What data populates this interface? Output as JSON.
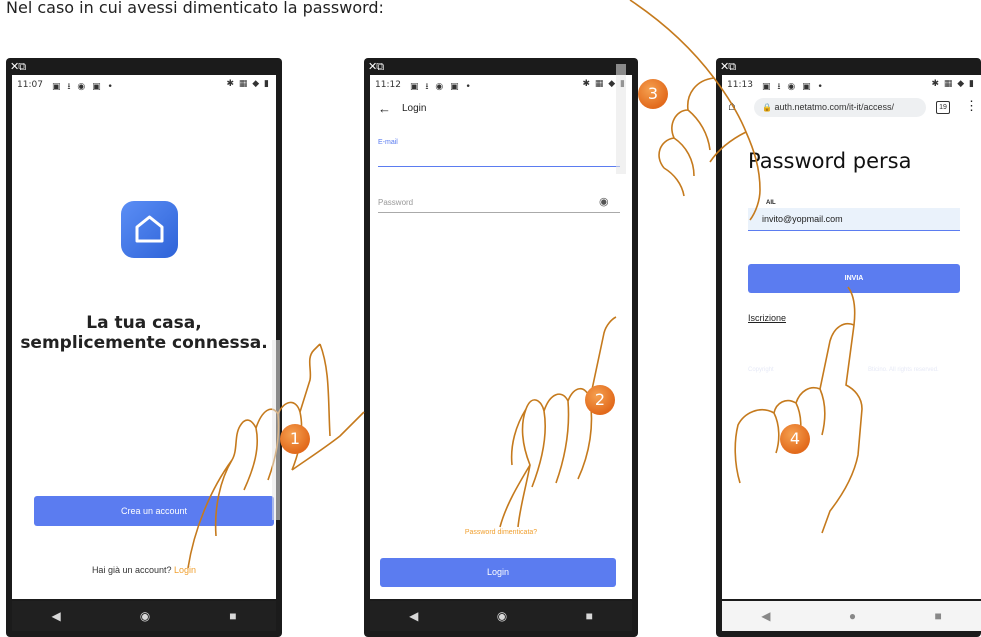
{
  "caption": "Nel caso in cui avessi dimenticato la password:",
  "phone1": {
    "time": "11:07",
    "welcome_line1": "La tua casa,",
    "welcome_line2": "semplicemente connessa.",
    "create_account": "Crea un account",
    "have_account": "Hai già un account?",
    "login_link": "Login"
  },
  "phone2": {
    "time": "11:12",
    "title": "Login",
    "email_label": "E-mail",
    "password_placeholder": "Password",
    "forgot": "Password dimenticata?",
    "login_button": "Login"
  },
  "phone3": {
    "time": "11:13",
    "url": "auth.netatmo.com/it-it/access/",
    "tab_count": "19",
    "title": "Password persa",
    "email_label": "AIL",
    "email_value": "invito@yopmail.com",
    "send_button": "INVIA",
    "signup": "Iscrizione",
    "copyright_left": "Copyright",
    "copyright_right": "Bticino. All rights reserved."
  },
  "badges": [
    "1",
    "2",
    "3",
    "4"
  ],
  "colors": {
    "accent": "#5b7cf0",
    "orange_link": "#f0a030",
    "badge": "#e26a1c"
  }
}
